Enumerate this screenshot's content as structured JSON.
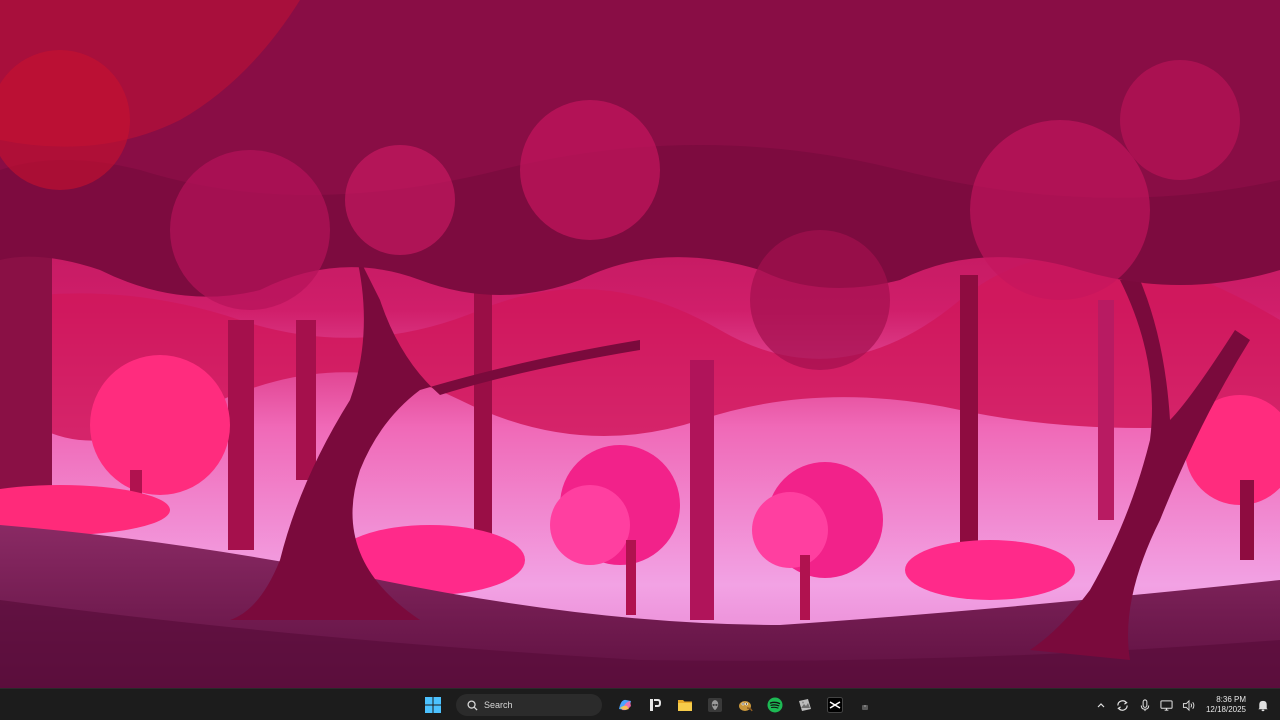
{
  "taskbar": {
    "search_label": "Search",
    "apps": [
      {
        "name": "Copilot",
        "icon": "copilot-icon",
        "color": "#4aa3ff"
      },
      {
        "name": "Parsec",
        "icon": "parsec-icon",
        "color": "#e6e6e6"
      },
      {
        "name": "File Explorer",
        "icon": "folder-icon",
        "color": "#f2c43c"
      },
      {
        "name": "Alienware Command Center",
        "icon": "alienware-icon",
        "color": "#5a5a5a"
      },
      {
        "name": "GIMP",
        "icon": "gimp-icon",
        "color": "#c9973b"
      },
      {
        "name": "Spotify",
        "icon": "spotify-icon",
        "color": "#1db954"
      },
      {
        "name": "Image viewer",
        "icon": "photos-icon",
        "color": "#9a9a9a"
      },
      {
        "name": "CapCut",
        "icon": "capcut-icon",
        "color": "#111111"
      },
      {
        "name": "App",
        "icon": "small-app-icon",
        "color": "#444444"
      }
    ],
    "clock": {
      "time": "8:36 PM",
      "date": "12/18/2025"
    }
  },
  "colors": {
    "taskbar_bg": "#1c1c1c",
    "start_blue": "#4cc2ff",
    "wallpaper_canopy": "#7a0a3a",
    "wallpaper_sky": "#ff9be0",
    "wallpaper_ground": "#6b1644"
  }
}
